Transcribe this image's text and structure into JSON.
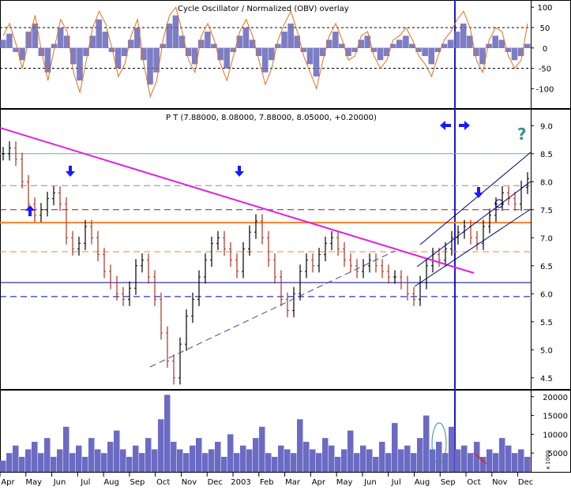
{
  "chart_data": [
    {
      "panel": "oscillator",
      "type": "bar+line",
      "title": "Cycle Oscillator / Normalized (OBV) overlay",
      "ylim": [
        -140,
        110
      ],
      "y_ticks": [
        "100",
        "50",
        "0",
        "-50",
        "-100"
      ],
      "reference_lines": [
        50,
        -50
      ],
      "series": [
        {
          "name": "histogram",
          "type": "bar",
          "color": "#6666bb",
          "values": [
            20,
            35,
            -10,
            -30,
            40,
            60,
            -20,
            -60,
            10,
            50,
            30,
            -40,
            -80,
            -20,
            30,
            70,
            40,
            -10,
            -50,
            -20,
            20,
            50,
            -30,
            -90,
            -60,
            10,
            60,
            80,
            30,
            -20,
            -40,
            20,
            40,
            10,
            -30,
            -50,
            -10,
            30,
            50,
            20,
            -20,
            -60,
            -30,
            10,
            40,
            60,
            30,
            -10,
            -40,
            -70,
            -20,
            20,
            40,
            10,
            -20,
            -10,
            20,
            30,
            -10,
            -30,
            -20,
            10,
            20,
            30,
            10,
            -10,
            -20,
            -40,
            -10,
            10,
            20,
            40,
            60,
            30,
            -20,
            -40,
            10,
            30,
            20,
            -10,
            -30,
            -20,
            10
          ]
        },
        {
          "name": "oscillator line",
          "type": "line",
          "color": "#e07020",
          "values": [
            30,
            60,
            10,
            -50,
            20,
            80,
            -10,
            -80,
            0,
            70,
            40,
            -60,
            -110,
            -30,
            50,
            90,
            60,
            0,
            -70,
            -40,
            30,
            70,
            -40,
            -120,
            -80,
            20,
            80,
            100,
            40,
            -30,
            -60,
            30,
            60,
            20,
            -40,
            -80,
            -20,
            40,
            70,
            30,
            -30,
            -90,
            -50,
            20,
            60,
            90,
            40,
            -20,
            -60,
            -100,
            -30,
            30,
            60,
            20,
            -30,
            -20,
            30,
            40,
            -20,
            -50,
            -30,
            20,
            30,
            50,
            20,
            -20,
            -40,
            -70,
            -20,
            20,
            40,
            70,
            90,
            50,
            -30,
            -60,
            20,
            50,
            40,
            -20,
            -50,
            -30,
            60
          ]
        }
      ]
    },
    {
      "panel": "price",
      "type": "ohlc",
      "legend": "P T (7.88000, 8.08000, 7.88000, 8.05000, +0.20000)",
      "ylim": [
        4.3,
        9.3
      ],
      "y_ticks": [
        "9.0",
        "8.5",
        "8.0",
        "7.5",
        "7.0",
        "6.5",
        "6.0",
        "5.5",
        "5.0",
        "4.5"
      ],
      "close": [
        8.5,
        8.6,
        8.4,
        8.0,
        7.6,
        7.4,
        7.5,
        7.7,
        7.8,
        7.6,
        7.0,
        6.8,
        6.9,
        7.2,
        7.0,
        6.7,
        6.4,
        6.2,
        6.0,
        5.9,
        6.1,
        6.5,
        6.6,
        6.3,
        5.9,
        5.3,
        4.8,
        4.5,
        5.1,
        5.6,
        5.9,
        6.3,
        6.6,
        6.9,
        7.0,
        6.8,
        6.6,
        6.4,
        6.8,
        7.1,
        7.3,
        7.0,
        6.6,
        6.3,
        5.9,
        5.7,
        6.0,
        6.4,
        6.6,
        6.5,
        6.7,
        6.9,
        7.0,
        6.8,
        6.6,
        6.5,
        6.4,
        6.5,
        6.6,
        6.5,
        6.4,
        6.3,
        6.3,
        6.2,
        6.0,
        5.9,
        6.2,
        6.5,
        6.7,
        6.6,
        6.8,
        7.0,
        7.1,
        7.2,
        7.0,
        6.9,
        7.2,
        7.4,
        7.6,
        7.8,
        7.7,
        7.6,
        7.9,
        8.05
      ],
      "horizontal_levels": [
        {
          "value": 8.5,
          "style": "solid",
          "color": "#66aaaa"
        },
        {
          "value": 7.93,
          "style": "dash",
          "color": "#a08080"
        },
        {
          "value": 7.5,
          "style": "dash",
          "color": "#8b2020"
        },
        {
          "value": 7.27,
          "style": "solid",
          "color": "#ff7f27"
        },
        {
          "value": 6.75,
          "style": "dash",
          "color": "#ff7f27"
        },
        {
          "value": 6.2,
          "style": "solid",
          "color": "#000080"
        },
        {
          "value": 5.95,
          "style": "dash",
          "color": "#0000cc"
        }
      ],
      "annotations": [
        "?"
      ]
    },
    {
      "panel": "volume",
      "type": "bar",
      "y_ticks": [
        "20000",
        "15000",
        "10000",
        "5000"
      ],
      "y_unit": "x 1000",
      "ylim": [
        0,
        21000
      ],
      "values": [
        3000,
        5000,
        7000,
        4000,
        6000,
        8000,
        5000,
        9000,
        4000,
        6000,
        12000,
        5000,
        7000,
        4000,
        9000,
        6000,
        5000,
        8000,
        11000,
        6000,
        4000,
        7000,
        5000,
        9000,
        6000,
        14000,
        20500,
        8000,
        6000,
        5000,
        7000,
        9000,
        5000,
        6000,
        8000,
        4000,
        10000,
        5000,
        7000,
        6000,
        9000,
        12000,
        5000,
        4000,
        7000,
        6000,
        5000,
        14000,
        8000,
        6000,
        5000,
        9000,
        7000,
        4000,
        6000,
        11000,
        5000,
        7000,
        6000,
        4000,
        8000,
        5000,
        13000,
        6000,
        7000,
        5000,
        9000,
        15000,
        6000,
        8000,
        5000,
        12000,
        6000,
        7000,
        5000,
        8000,
        4000,
        6000,
        5000,
        9000,
        7000,
        5000,
        6000,
        4000
      ]
    }
  ],
  "x_axis": {
    "labels": [
      "Apr",
      "May",
      "Jun",
      "Jul",
      "Aug",
      "Sep",
      "Oct",
      "Nov",
      "Dec",
      "2003",
      "Feb",
      "Mar",
      "Apr",
      "May",
      "Jun",
      "Jul",
      "Aug",
      "Sep",
      "Oct",
      "Nov",
      "Dec"
    ]
  }
}
